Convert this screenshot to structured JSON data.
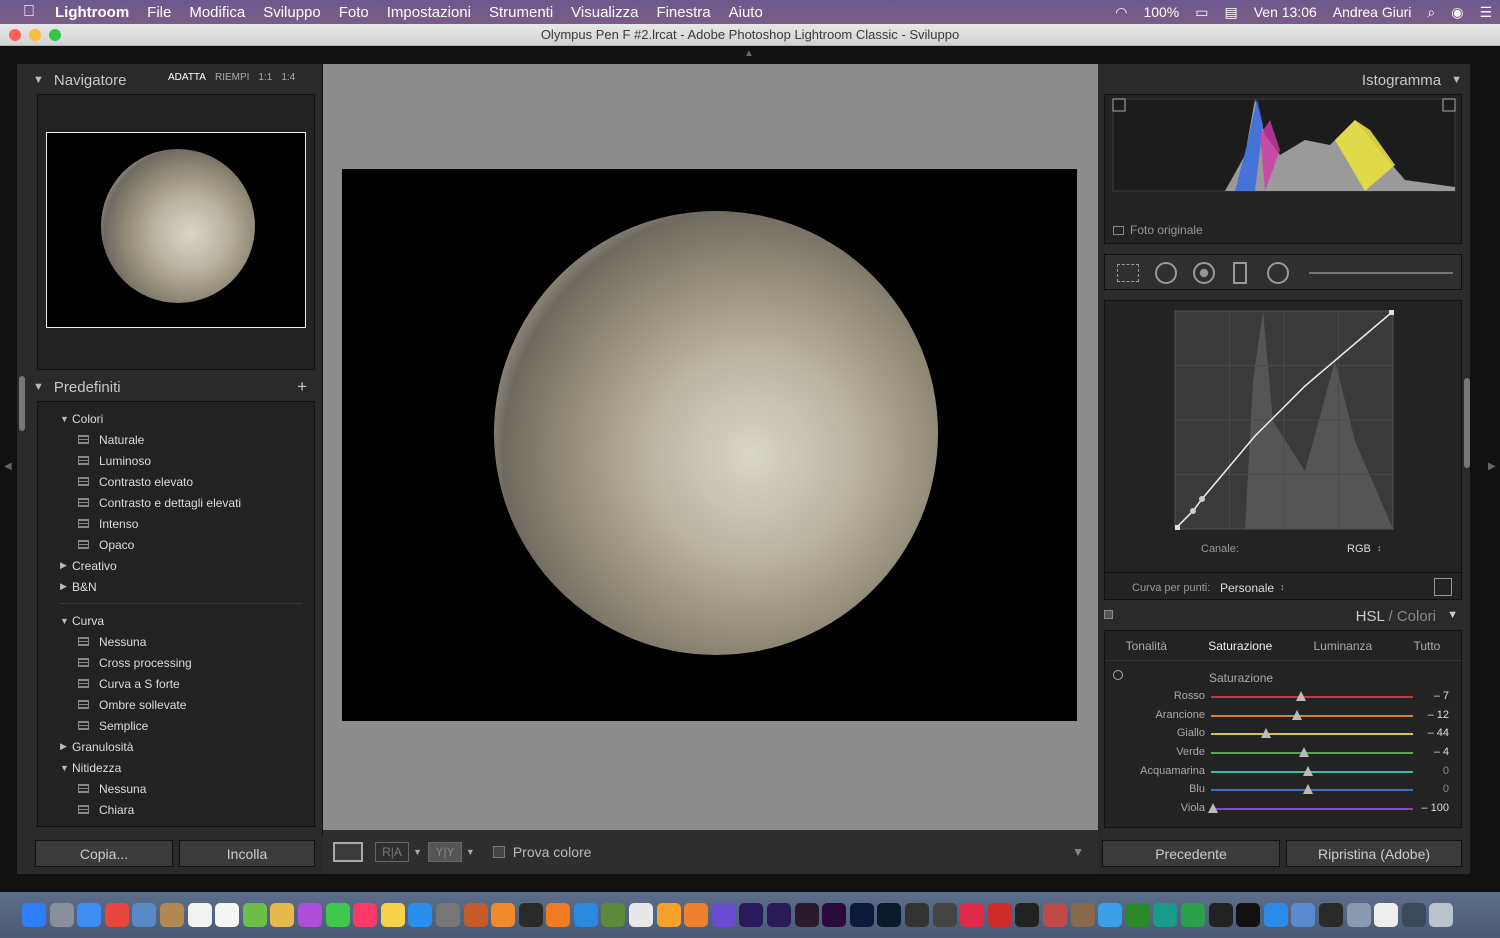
{
  "menubar": {
    "app": "Lightroom",
    "items": [
      "File",
      "Modifica",
      "Sviluppo",
      "Foto",
      "Impostazioni",
      "Strumenti",
      "Visualizza",
      "Finestra",
      "Aiuto"
    ],
    "battery": "100%",
    "clock": "Ven 13:06",
    "user": "Andrea Giuri"
  },
  "window": {
    "title": "Olympus Pen F #2.lrcat - Adobe Photoshop Lightroom Classic - Sviluppo"
  },
  "navigator": {
    "title": "Navigatore",
    "zoom_options": [
      "ADATTA",
      "RIEMPI",
      "1:1",
      "1:4"
    ]
  },
  "presets": {
    "title": "Predefiniti",
    "groups": [
      {
        "name": "Colori",
        "items": [
          "Naturale",
          "Luminoso",
          "Contrasto elevato",
          "Contrasto e dettagli elevati",
          "Intenso",
          "Opaco"
        ]
      },
      {
        "name": "Creativo"
      },
      {
        "name": "B&N"
      },
      {
        "name": "Curva",
        "items": [
          "Nessuna",
          "Cross processing",
          "Curva a S forte",
          "Ombre sollevate",
          "Semplice"
        ]
      },
      {
        "name": "Granulosità"
      },
      {
        "name": "Nitidezza",
        "items": [
          "Nessuna",
          "Chiara"
        ]
      }
    ]
  },
  "left_buttons": {
    "copy": "Copia...",
    "paste": "Incolla"
  },
  "toolbar": {
    "proof": "Prova colore"
  },
  "histogram": {
    "title": "Istogramma",
    "original": "Foto originale"
  },
  "tone_curve": {
    "channel_label": "Canale:",
    "channel_value": "RGB",
    "point_curve_label": "Curva per punti:",
    "point_curve_value": "Personale"
  },
  "hsl": {
    "title": "HSL",
    "title2": "Colori",
    "tabs": [
      "Tonalità",
      "Saturazione",
      "Luminanza",
      "Tutto"
    ],
    "section": "Saturazione",
    "sliders": [
      {
        "label": "Rosso",
        "value": "– 7",
        "color": "#c0393b"
      },
      {
        "label": "Arancione",
        "value": "– 12",
        "color": "#d9812c"
      },
      {
        "label": "Giallo",
        "value": "– 44",
        "color": "#d6c640"
      },
      {
        "label": "Verde",
        "value": "– 4",
        "color": "#4aae4a"
      },
      {
        "label": "Acquamarina",
        "value": "0",
        "color": "#3cb7a8"
      },
      {
        "label": "Blu",
        "value": "0",
        "color": "#3a6fd8"
      },
      {
        "label": "Viola",
        "value": "– 100",
        "color": "#8e45c8"
      }
    ]
  },
  "right_buttons": {
    "prev": "Precedente",
    "reset": "Ripristina (Adobe)"
  }
}
